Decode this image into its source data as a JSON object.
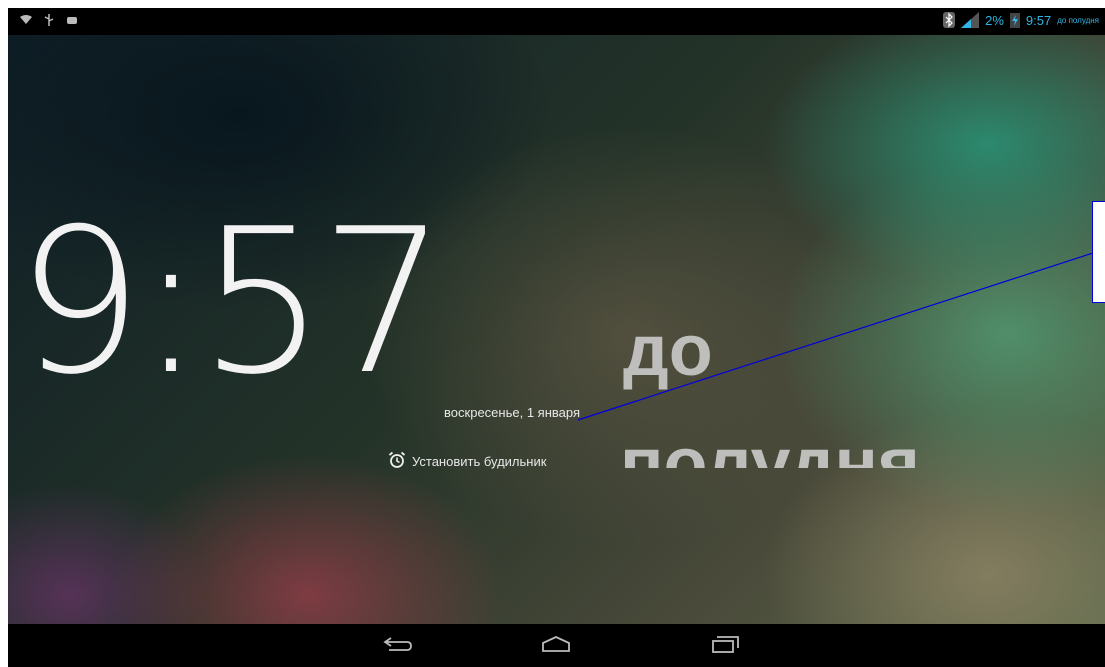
{
  "status_bar": {
    "battery_percent": "2%",
    "time": "9:57",
    "time_suffix": "до полудня",
    "icons": [
      "wifi-icon",
      "usb-icon",
      "android-debug-icon",
      "bluetooth-icon",
      "signal-icon",
      "battery-charging-icon"
    ]
  },
  "lockscreen": {
    "clock_time": "9:57",
    "am_pm_line1": "до",
    "am_pm_line2": "полудня",
    "date": "воскресенье, 1 января",
    "alarm_label": "Установить будильник",
    "alarm_icon": "alarm-clock-icon"
  },
  "navigation_bar": {
    "buttons": [
      "back-icon",
      "home-icon",
      "recent-apps-icon"
    ]
  },
  "colors": {
    "status_accent": "#33b5e5",
    "annotation": "#0000dd"
  }
}
